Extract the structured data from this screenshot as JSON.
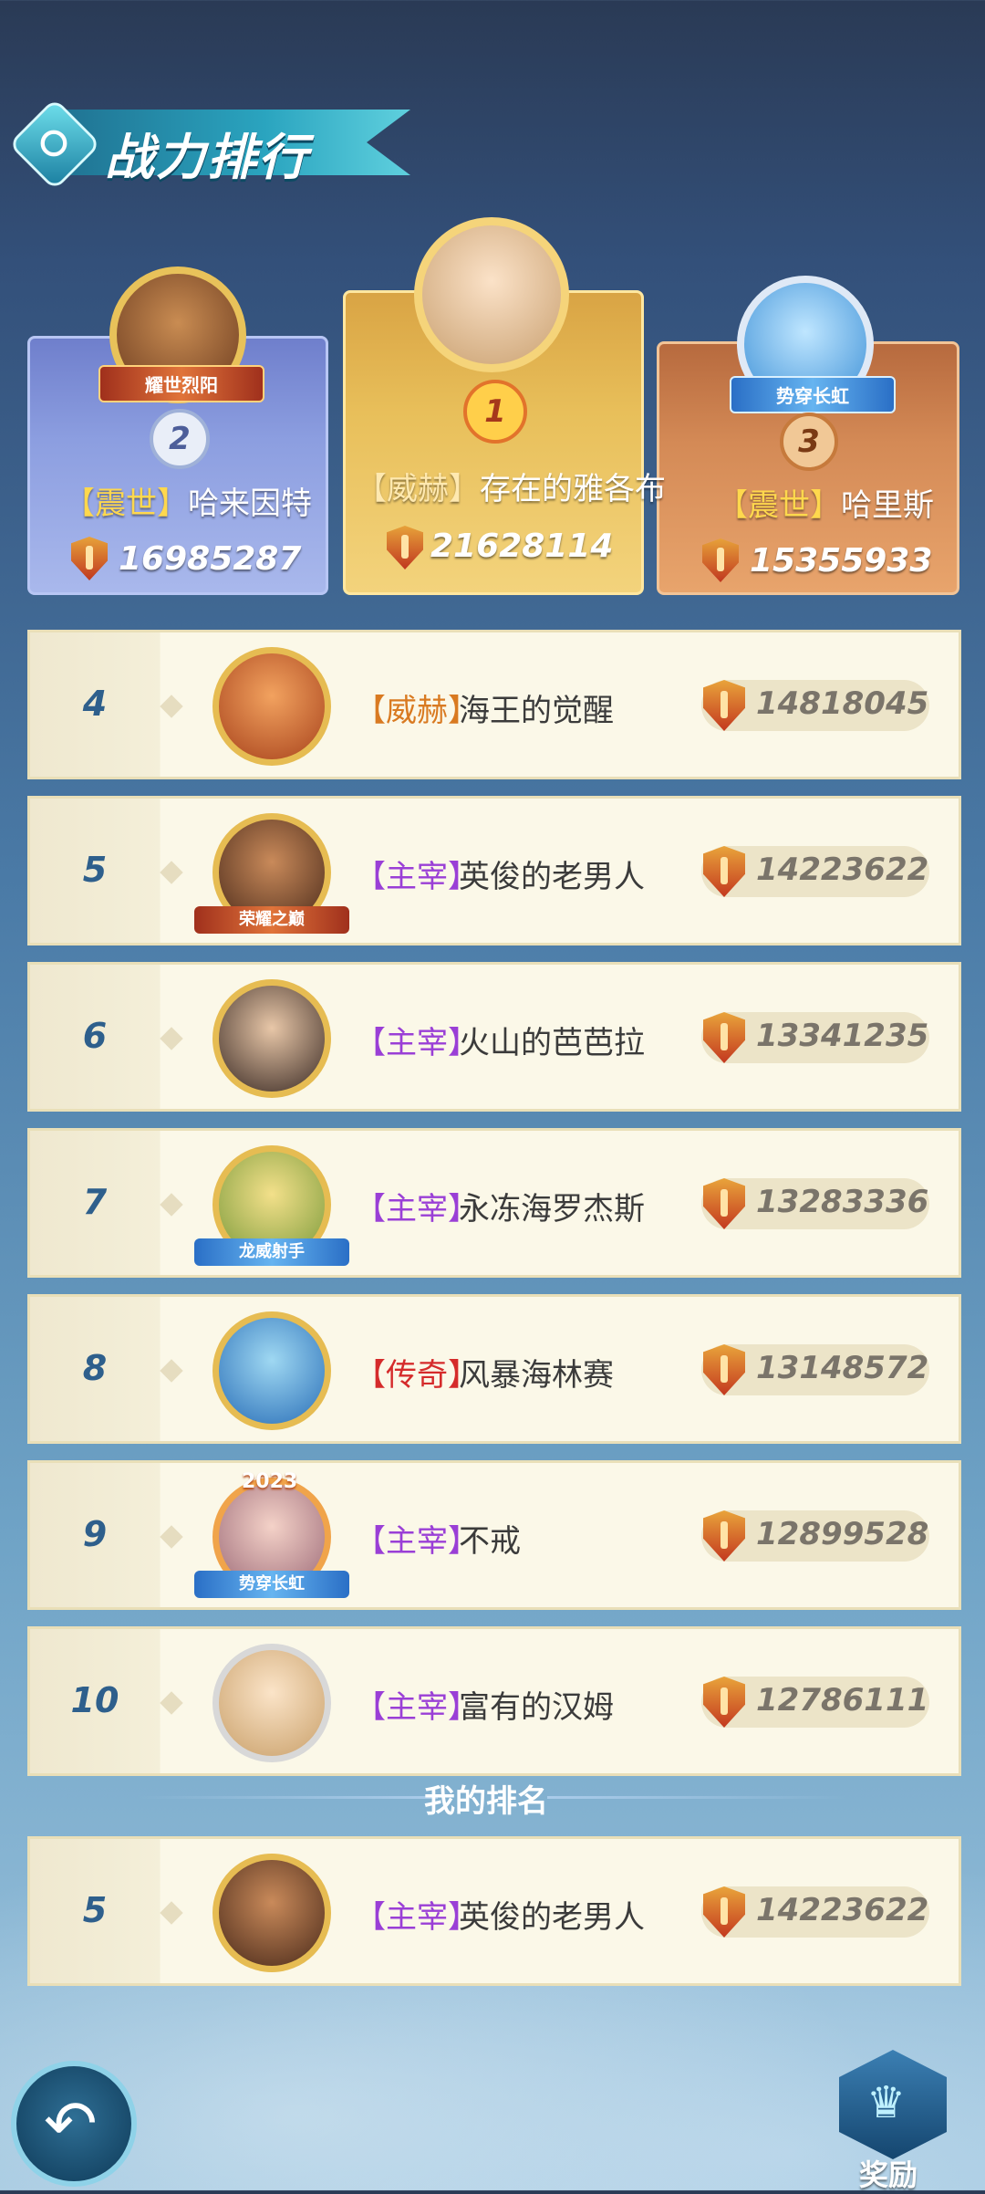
{
  "title": "战力排行",
  "podium": {
    "second": {
      "rank": "2",
      "tag": "耀世烈阳",
      "guild": "【震世】",
      "name": "哈来因特",
      "power": "16985287"
    },
    "first": {
      "rank": "1",
      "guild": "【威赫】",
      "name": "存在的雅各布",
      "power": "21628114"
    },
    "third": {
      "rank": "3",
      "tag": "势穿长虹",
      "guild": "【震世】",
      "name": "哈里斯",
      "power": "15355933"
    }
  },
  "rankings": [
    {
      "rank": "4",
      "guild": "【威赫】",
      "name": "海王的觉醒",
      "power": "14818045",
      "guild_color": "orange"
    },
    {
      "rank": "5",
      "guild": "【主宰】",
      "name": "英俊的老男人",
      "power": "14223622",
      "guild_color": "purple",
      "avatar_tag": "荣耀之巅"
    },
    {
      "rank": "6",
      "guild": "【主宰】",
      "name": "火山的芭芭拉",
      "power": "13341235",
      "guild_color": "purple"
    },
    {
      "rank": "7",
      "guild": "【主宰】",
      "name": "永冻海罗杰斯",
      "power": "13283336",
      "guild_color": "purple",
      "avatar_tag": "龙威射手"
    },
    {
      "rank": "8",
      "guild": "【传奇】",
      "name": "风暴海林赛",
      "power": "13148572",
      "guild_color": "red"
    },
    {
      "rank": "9",
      "guild": "【主宰】",
      "name": "不戒",
      "power": "12899528",
      "guild_color": "purple",
      "avatar_tag": "势穿长虹",
      "avatar_year": "2023"
    },
    {
      "rank": "10",
      "guild": "【主宰】",
      "name": "富有的汉姆",
      "power": "12786111",
      "guild_color": "purple"
    }
  ],
  "my_rank_label": "我的排名",
  "my_rank": {
    "rank": "5",
    "guild": "【主宰】",
    "name": "英俊的老男人",
    "power": "14223622"
  },
  "buttons": {
    "reward_label": "奖励"
  },
  "colors": {
    "rank_blue": "#2e5f8c",
    "guild_purple": "#9a3fd6",
    "guild_orange": "#d97a21",
    "guild_red": "#d52b2b"
  }
}
